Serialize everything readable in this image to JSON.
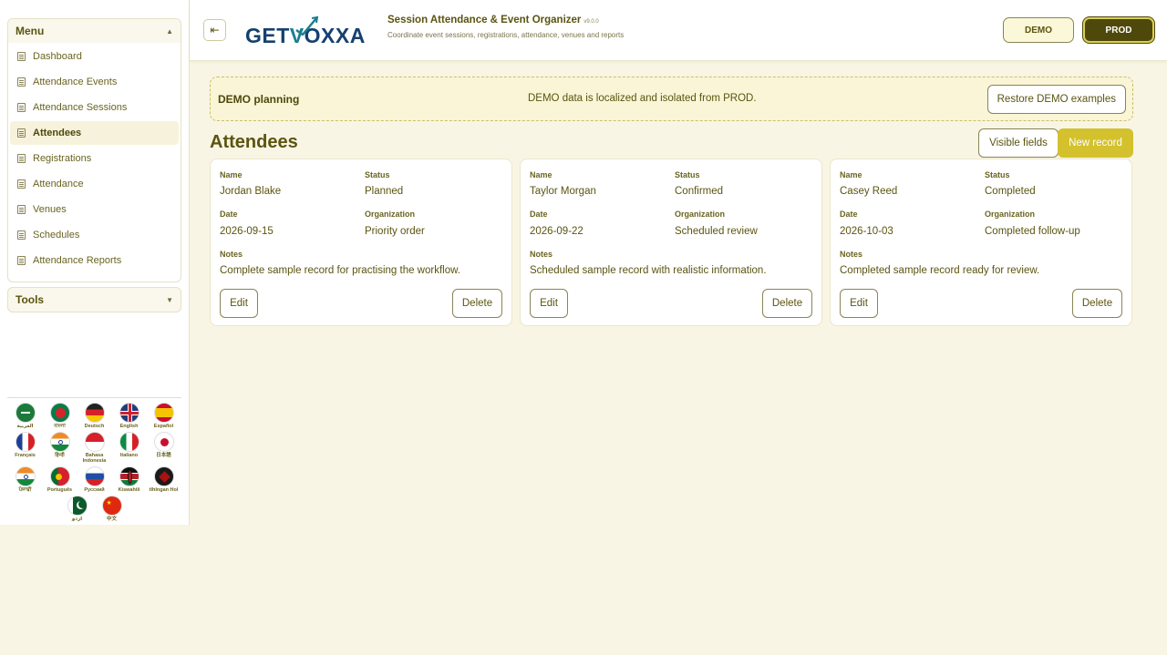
{
  "sidebar": {
    "menu_title": "Menu",
    "items": [
      {
        "label": "Dashboard"
      },
      {
        "label": "Attendance Events"
      },
      {
        "label": "Attendance Sessions"
      },
      {
        "label": "Attendees"
      },
      {
        "label": "Registrations"
      },
      {
        "label": "Attendance"
      },
      {
        "label": "Venues"
      },
      {
        "label": "Schedules"
      },
      {
        "label": "Attendance Reports"
      }
    ],
    "active_item": "Attendees",
    "tools_title": "Tools",
    "languages": [
      {
        "name": "العربية",
        "flag": "saudi-arabia"
      },
      {
        "name": "বাংলা",
        "flag": "bangladesh"
      },
      {
        "name": "Deutsch",
        "flag": "germany"
      },
      {
        "name": "English",
        "flag": "united-kingdom"
      },
      {
        "name": "Español",
        "flag": "spain"
      },
      {
        "name": "Français",
        "flag": "france"
      },
      {
        "name": "हिन्दी",
        "flag": "india"
      },
      {
        "name": "Bahasa Indonesia",
        "flag": "indonesia"
      },
      {
        "name": "Italiano",
        "flag": "italy"
      },
      {
        "name": "日本語",
        "flag": "japan"
      },
      {
        "name": "ਪੰਜਾਬੀ",
        "flag": "india"
      },
      {
        "name": "Português",
        "flag": "portugal"
      },
      {
        "name": "Русский",
        "flag": "russia"
      },
      {
        "name": "Kiswahili",
        "flag": "kenya"
      },
      {
        "name": "tlhIngan Hol",
        "flag": "klingon"
      },
      {
        "name": "اردو",
        "flag": "pakistan"
      },
      {
        "name": "中文",
        "flag": "china"
      }
    ]
  },
  "header": {
    "collapse_icon": "sidebar-collapse-icon",
    "logo_text_1": "GET",
    "logo_text_v": "V",
    "logo_text_2": "OXXA",
    "app_title": "Session Attendance & Event Organizer",
    "version": "v9.0.0",
    "subtitle": "Coordinate event sessions, registrations, attendance, venues and reports",
    "env_demo": "DEMO",
    "env_prod": "PROD",
    "active_env": "PROD"
  },
  "banner": {
    "title": "DEMO planning",
    "message": "DEMO data is localized and isolated from PROD.",
    "restore_label": "Restore DEMO examples"
  },
  "main": {
    "title": "Attendees",
    "visible_fields_label": "Visible fields",
    "new_record_label": "New record",
    "field_labels": {
      "name": "Name",
      "status": "Status",
      "date": "Date",
      "organization": "Organization",
      "notes": "Notes"
    },
    "edit_label": "Edit",
    "delete_label": "Delete",
    "records": [
      {
        "name": "Jordan Blake",
        "status": "Planned",
        "date": "2026-09-15",
        "organization": "Priority order",
        "notes": "Complete sample record for practising the workflow."
      },
      {
        "name": "Taylor Morgan",
        "status": "Confirmed",
        "date": "2026-09-22",
        "organization": "Scheduled review",
        "notes": "Scheduled sample record with realistic information."
      },
      {
        "name": "Casey Reed",
        "status": "Completed",
        "date": "2026-10-03",
        "organization": "Completed follow-up",
        "notes": "Completed sample record ready for review."
      }
    ]
  }
}
